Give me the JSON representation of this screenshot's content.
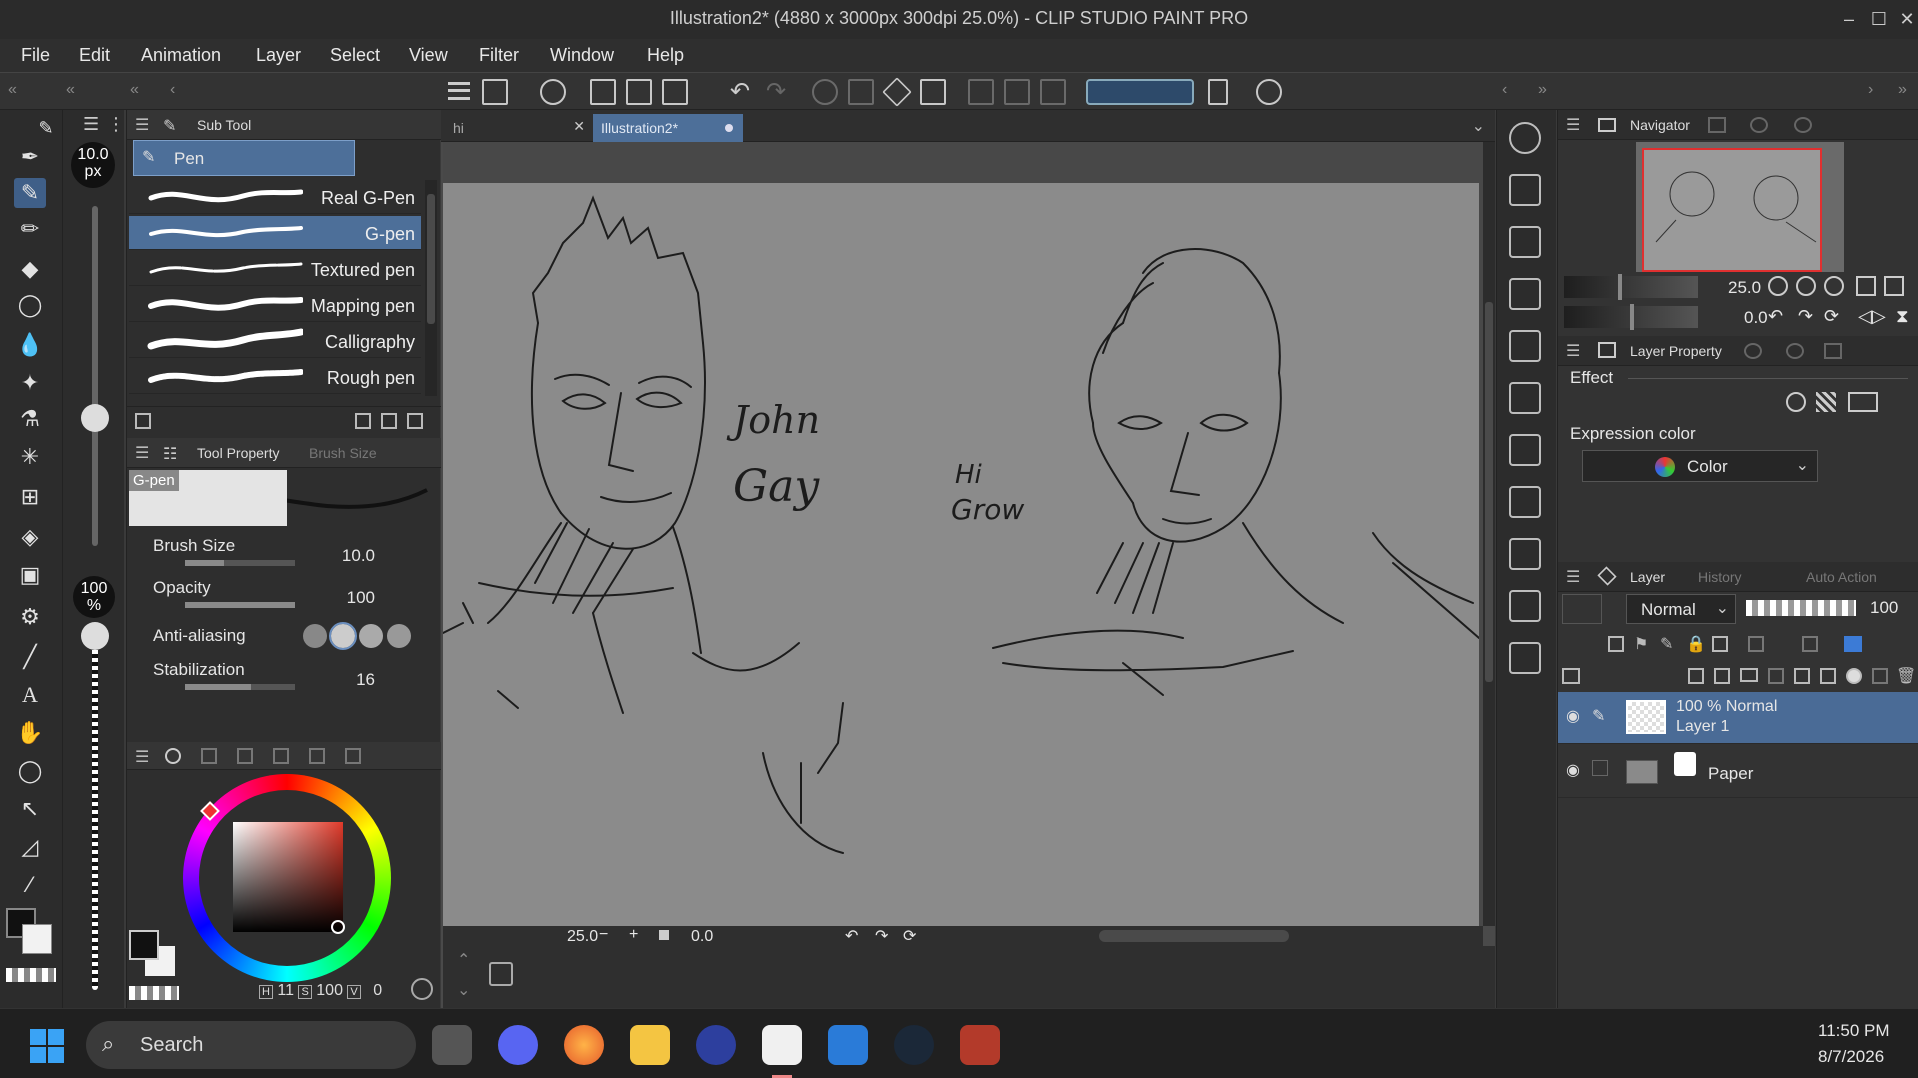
{
  "window": {
    "title": "Illustration2* (4880 x 3000px 300dpi 25.0%)  - CLIP STUDIO PAINT PRO"
  },
  "menu": [
    "File",
    "Edit",
    "Animation",
    "Layer",
    "Select",
    "View",
    "Filter",
    "Window",
    "Help"
  ],
  "brush_size_badge": {
    "value": "10.0",
    "unit": "px"
  },
  "opacity_badge": {
    "value": "100",
    "unit": "%"
  },
  "sub_tool": {
    "header": "Sub Tool",
    "group": "Pen",
    "brushes": [
      "Real G-Pen",
      "G-pen",
      "Textured pen",
      "Mapping pen",
      "Calligraphy",
      "Rough pen"
    ],
    "selected": "G-pen"
  },
  "tool_property": {
    "tabs": [
      "Tool Property",
      "Brush Size"
    ],
    "preset": "G-pen",
    "rows": [
      {
        "label": "Brush Size",
        "value": "10.0",
        "level": 0.35
      },
      {
        "label": "Opacity",
        "value": "100",
        "level": 1.0
      },
      {
        "label": "Anti-aliasing",
        "value": ""
      },
      {
        "label": "Stabilization",
        "value": "16",
        "level": 0.6
      }
    ]
  },
  "color_panel": {
    "footer_values": [
      "11",
      "100",
      "0"
    ],
    "main_color": "#111111",
    "sub_color": "#f2f2f2",
    "picked": "#d85a4a"
  },
  "doc_tabs": [
    {
      "label": "hi",
      "active": false
    },
    {
      "label": "Illustration2*",
      "active": true
    }
  ],
  "canvas_text": [
    "John",
    "Gay",
    "Hi",
    "Grow"
  ],
  "status": {
    "zoom": "25.0",
    "angle": "0.0"
  },
  "navigator": {
    "title": "Navigator",
    "zoom": "25.0",
    "angle": "0.0"
  },
  "layer_property": {
    "title": "Layer Property",
    "effect_label": "Effect",
    "expression_label": "Expression color",
    "expression_value": "Color"
  },
  "layer_panel": {
    "tabs": [
      "Layer",
      "History",
      "Auto Action"
    ],
    "blend_mode": "Normal",
    "opacity": "100",
    "layers": [
      {
        "meta": "100 % Normal",
        "name": "Layer 1",
        "selected": true
      },
      {
        "meta": "",
        "name": "Paper",
        "selected": false
      }
    ]
  },
  "taskbar": {
    "search": "Search",
    "time": "11:50 PM",
    "date": "8/7/2026"
  }
}
